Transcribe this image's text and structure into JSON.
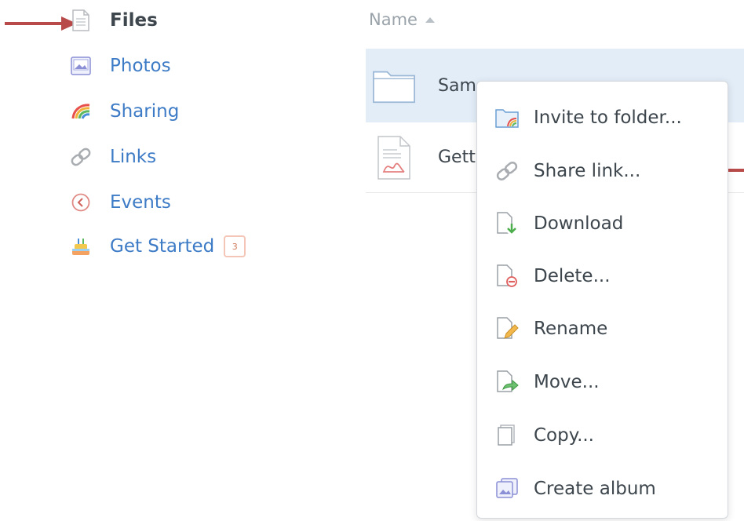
{
  "sidebar": {
    "items": [
      {
        "label": "Files",
        "icon": "file-icon"
      },
      {
        "label": "Photos",
        "icon": "photo-icon"
      },
      {
        "label": "Sharing",
        "icon": "rainbow-icon"
      },
      {
        "label": "Links",
        "icon": "link-icon"
      },
      {
        "label": "Events",
        "icon": "clock-icon"
      },
      {
        "label": "Get Started",
        "icon": "cake-icon",
        "badge": "3"
      }
    ]
  },
  "file_list": {
    "column_header": "Name",
    "sort": "ascending",
    "rows": [
      {
        "name": "Sam",
        "type": "folder",
        "selected": true
      },
      {
        "name": "Gett",
        "type": "pdf",
        "selected": false
      }
    ]
  },
  "context_menu": {
    "items": [
      {
        "label": "Invite to folder...",
        "icon": "shared-folder-icon"
      },
      {
        "label": "Share link...",
        "icon": "link-icon"
      },
      {
        "label": "Download",
        "icon": "download-icon"
      },
      {
        "label": "Delete...",
        "icon": "delete-icon"
      },
      {
        "label": "Rename",
        "icon": "rename-icon"
      },
      {
        "label": "Move...",
        "icon": "move-icon"
      },
      {
        "label": "Copy...",
        "icon": "copy-icon"
      },
      {
        "label": "Create album",
        "icon": "album-icon"
      }
    ]
  },
  "colors": {
    "accent_link": "#3d7bc6",
    "selected_row": "#e3edf8",
    "annotation_arrow": "#b84a4a"
  }
}
